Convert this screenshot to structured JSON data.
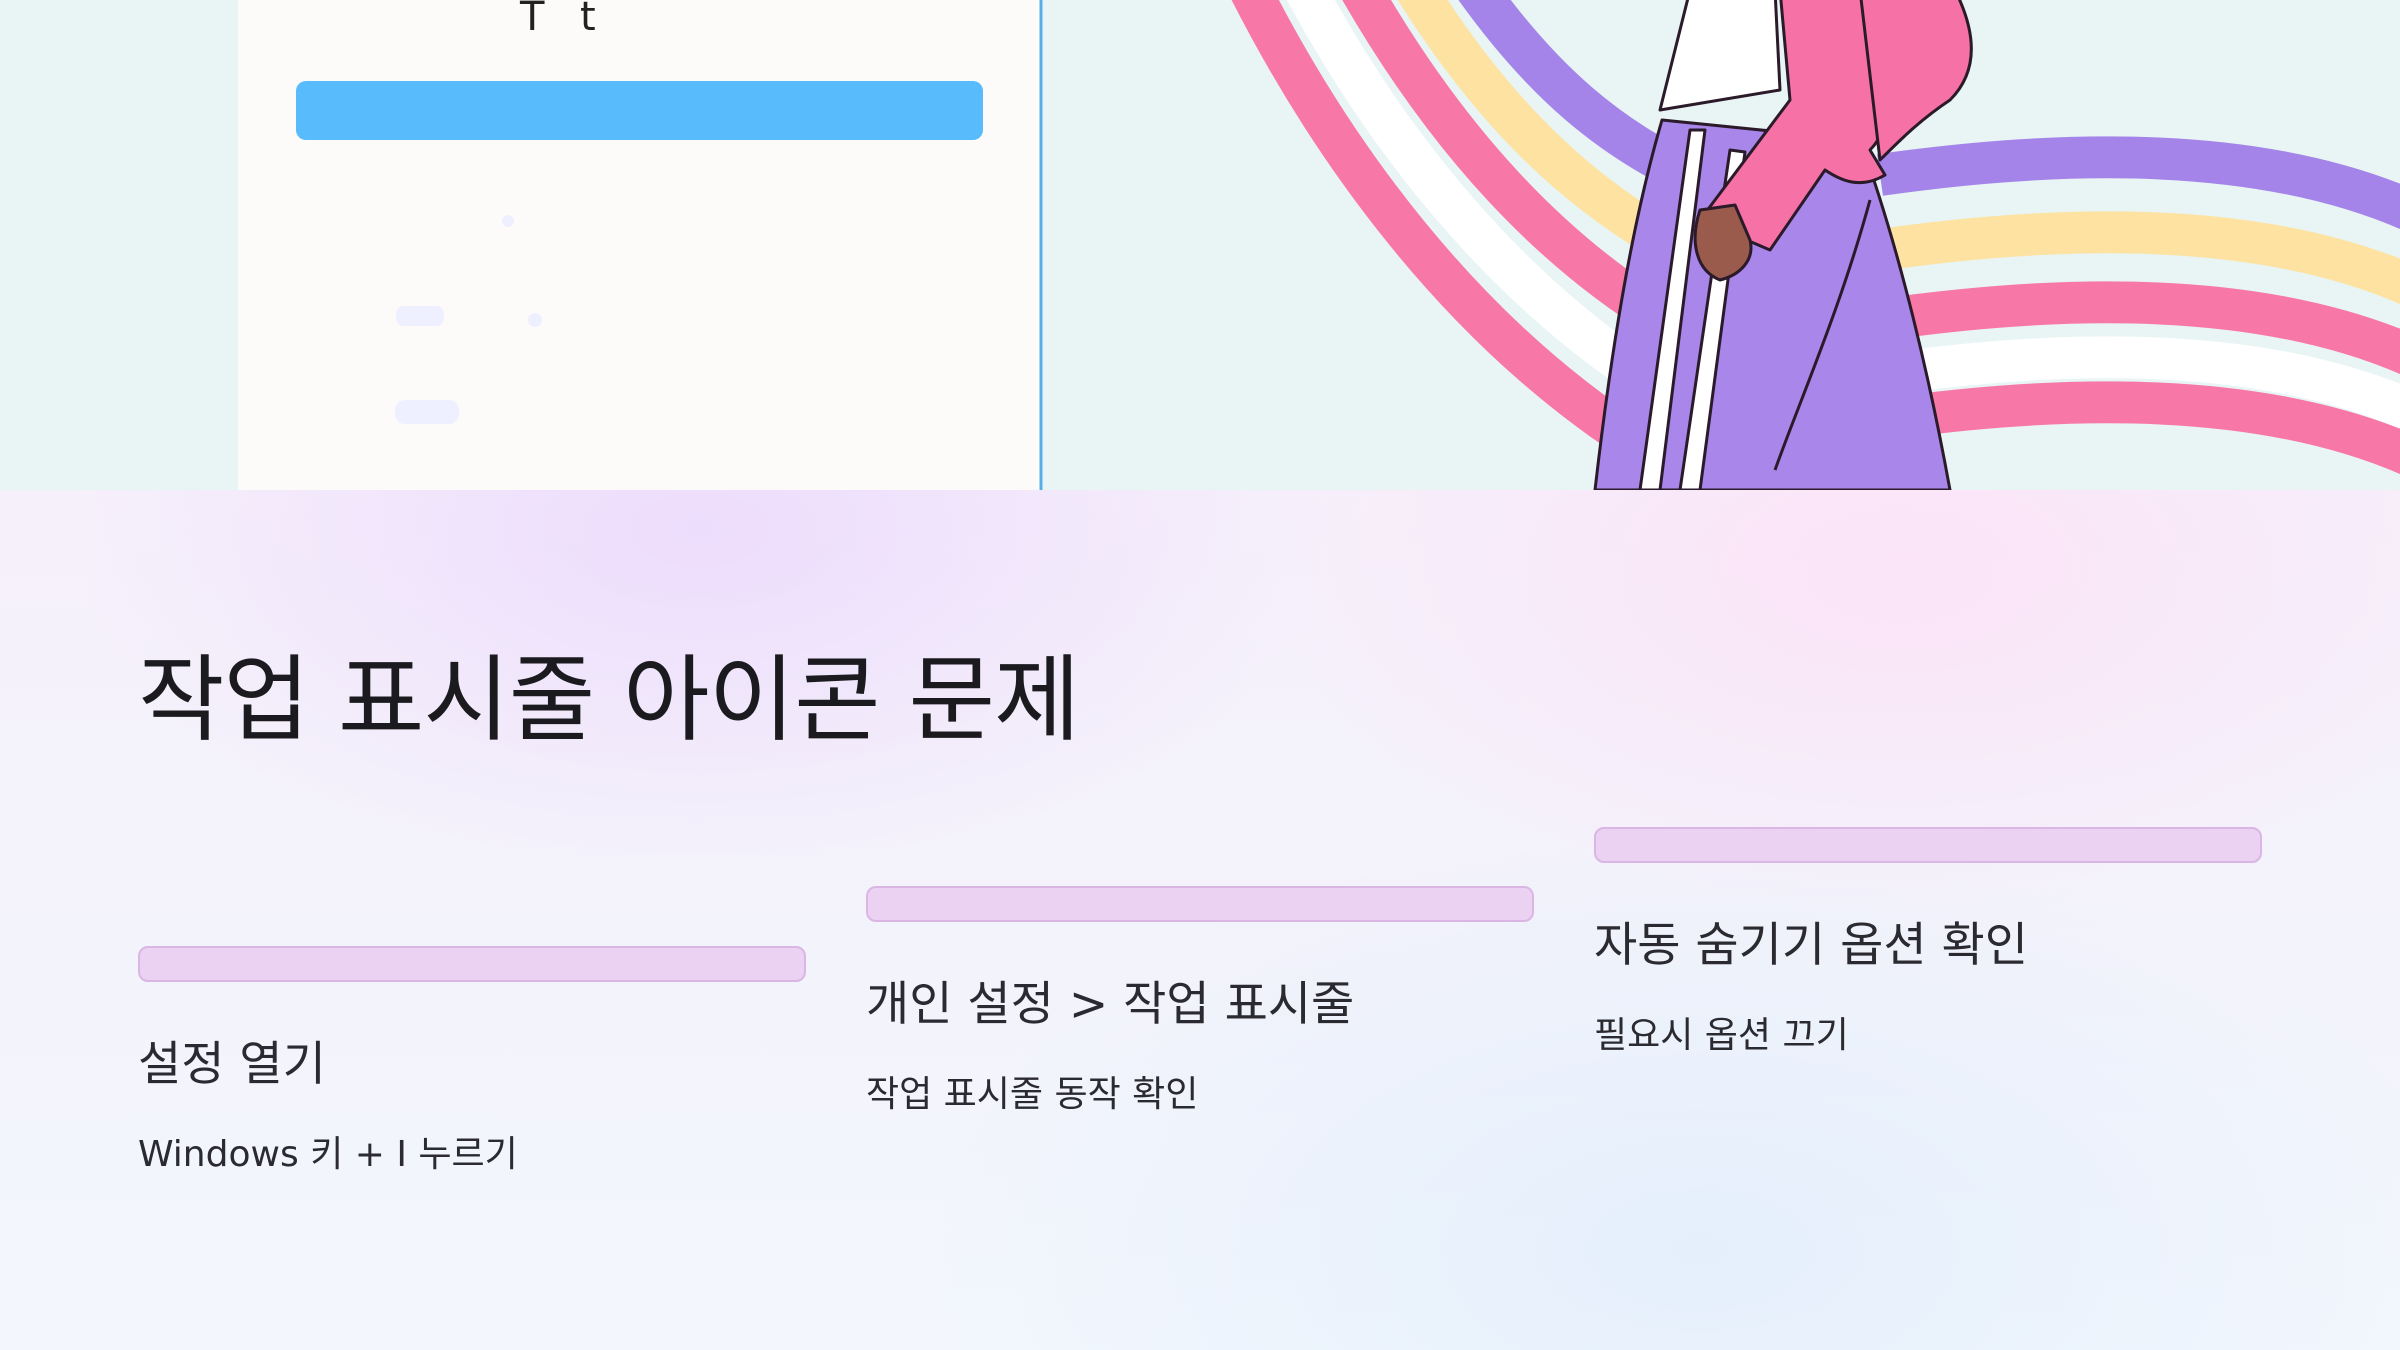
{
  "slide": {
    "title": "작업 표시줄 아이콘 문제",
    "steps": [
      {
        "heading": "설정 열기",
        "description": "Windows 키 + I 누르기"
      },
      {
        "heading": "개인 설정 > 작업 표시줄",
        "description": "작업 표시줄 동작 확인"
      },
      {
        "heading": "자동 숨기기 옵션 확인",
        "description": "필요시 옵션 끄기"
      }
    ]
  },
  "illustration": {
    "window_text_fragments": [
      "T",
      "t"
    ],
    "colors": {
      "background": "#e8f5f4",
      "window": "#fcfbf9",
      "window_bar": "#58bbfb",
      "rainbow_pink": "#f778a7",
      "rainbow_white": "#ffffff",
      "rainbow_yellow": "#fde2a1",
      "rainbow_purple": "#a584ea",
      "jacket": "#f672a6",
      "pants": "#a886ea",
      "skin": "#9a5a4c"
    }
  },
  "colors": {
    "step_bar_fill": "#ecd2f2",
    "step_bar_border": "#d9b6e4",
    "text": "#1b1b1f"
  }
}
